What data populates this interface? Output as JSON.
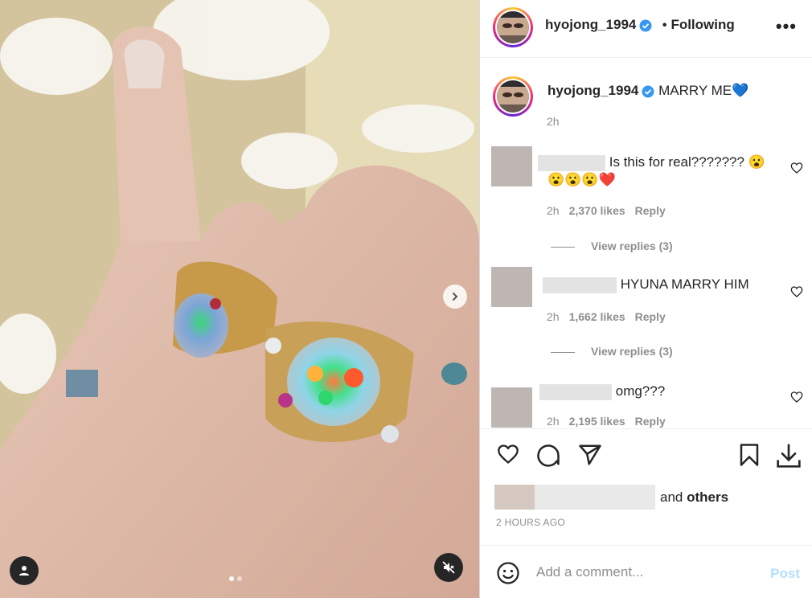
{
  "post": {
    "username": "hyojong_1994",
    "following_label": "Following",
    "more_label": "•••",
    "separator": "•"
  },
  "caption": {
    "username": "hyojong_1994",
    "text": "MARRY ME💙",
    "time": "2h"
  },
  "comments": [
    {
      "text": "Is this for real??????? 😮",
      "text2": "😮😮😮❤️",
      "time": "2h",
      "likes": "2,370 likes",
      "reply": "Reply",
      "view_replies": "View replies (3)"
    },
    {
      "text": "HYUNA MARRY HIM",
      "time": "2h",
      "likes": "1,662 likes",
      "reply": "Reply",
      "view_replies": "View replies (3)"
    },
    {
      "text": "omg???",
      "time": "2h",
      "likes": "2,195 likes",
      "reply": "Reply"
    }
  ],
  "likes": {
    "and": "and",
    "others": "others"
  },
  "time_ago": "2 HOURS AGO",
  "add_comment": {
    "placeholder": "Add a comment...",
    "post_label": "Post"
  },
  "colors": {
    "verified": "#3897f0",
    "post_disabled": "#b2dffc",
    "muted": "#8e8e8e"
  },
  "icons": [
    "next-arrow-icon",
    "person-tag-icon",
    "mute-icon",
    "heart-icon",
    "comment-icon",
    "share-icon",
    "bookmark-icon",
    "download-icon",
    "emoji-icon",
    "verified-badge-icon"
  ]
}
